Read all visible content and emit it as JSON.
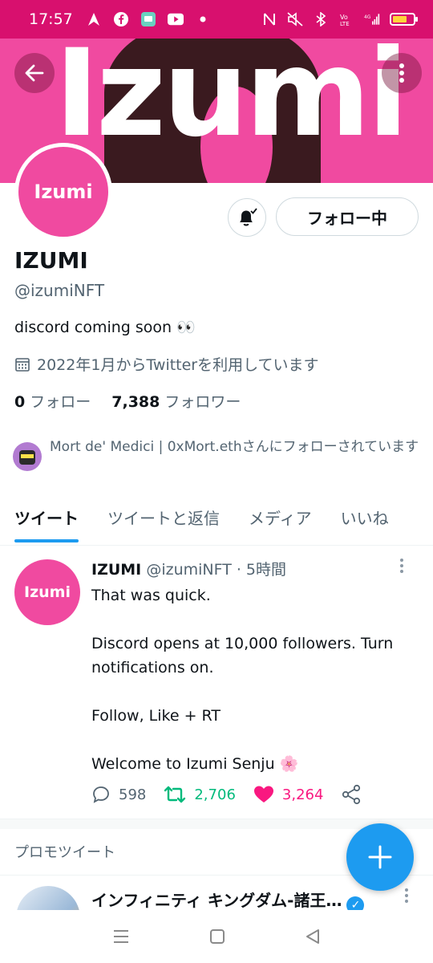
{
  "status_bar": {
    "time": "17:57",
    "left_icons": [
      "signal-arrow-icon",
      "facebook-icon",
      "message-icon",
      "youtube-icon",
      "dot-icon"
    ],
    "right_icons": [
      "nfc-icon",
      "mute-icon",
      "bluetooth-icon",
      "volte-icon",
      "4g-signal-icon",
      "battery-icon"
    ],
    "battery_level": 0.7,
    "colors": {
      "background": "#d8106e",
      "battery": "#ffd43b"
    }
  },
  "banner": {
    "text": "Izumi",
    "color": "#f04aa0"
  },
  "profile": {
    "avatar_text": "Izumi",
    "follow_button": "フォロー中",
    "display_name": "IZUMI",
    "handle": "@izumiNFT",
    "bio": "discord coming soon 👀",
    "joined": "2022年1月からTwitterを利用しています",
    "following_count": "0",
    "following_label": "フォロー",
    "followers_count": "7,388",
    "followers_label": "フォロワー",
    "followed_by": "Mort de' Medici | 0xMort.ethさんにフォローされています"
  },
  "tabs": [
    {
      "label": "ツイート",
      "active": true
    },
    {
      "label": "ツイートと返信",
      "active": false
    },
    {
      "label": "メディア",
      "active": false
    },
    {
      "label": "いいね",
      "active": false
    }
  ],
  "tweet": {
    "avatar_text": "Izumi",
    "name": "IZUMI",
    "handle_time": "@izumiNFT · 5時間",
    "body": [
      "That was quick.",
      "Discord opens at 10,000 followers. Turn notifications on.",
      "Follow, Like + RT",
      "Welcome to Izumi Senju 🌸"
    ],
    "replies": "598",
    "retweets": "2,706",
    "likes": "3,264",
    "colors": {
      "retweet": "#00ba7c",
      "like": "#f91880"
    }
  },
  "promoted": {
    "label": "プロモツイート",
    "title": "インフィニティ キングダム-諸王…"
  },
  "accent": "#1d9bf0"
}
